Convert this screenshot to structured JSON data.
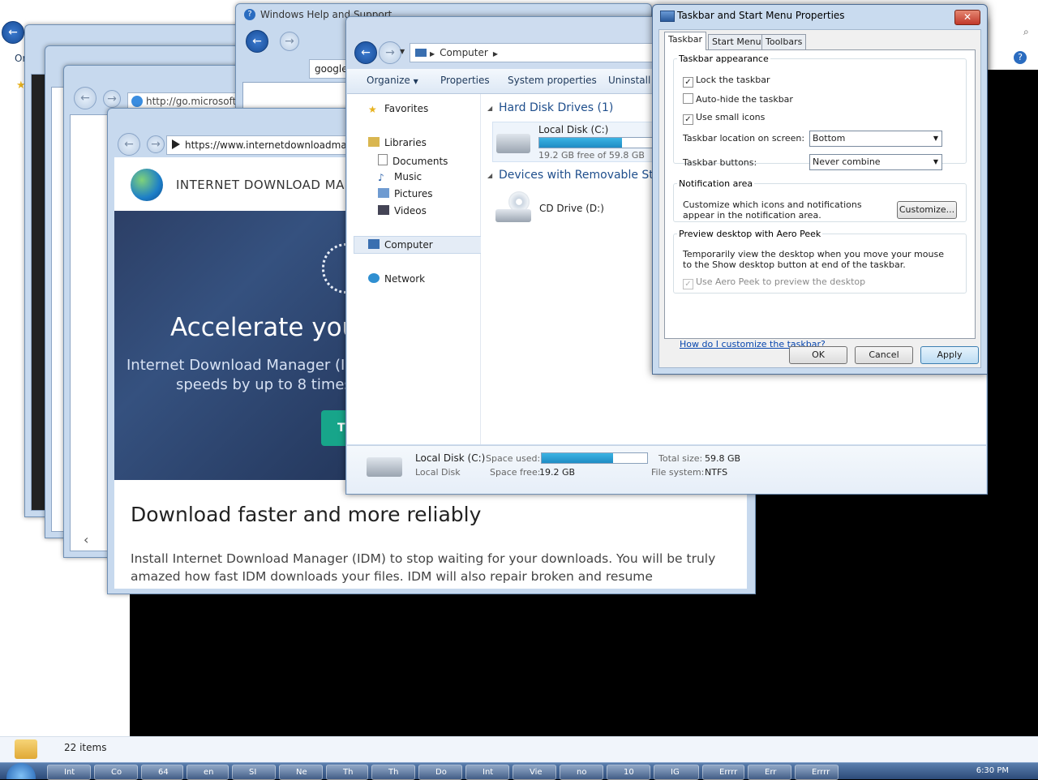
{
  "background_explorer": {
    "status_items": "22 items",
    "toolbar_fragment": "Or"
  },
  "help_window": {
    "title": "Windows Help and Support",
    "search_value": "google"
  },
  "go_microsoft_window": {
    "url": "http://go.microsoft."
  },
  "idm_browser": {
    "url": "https://www.internetdownloadmana",
    "brand": "INTERNET DOWNLOAD MA",
    "hero_title": "Accelerate your",
    "hero_sub1": "Internet Download Manager (IDM",
    "hero_sub2": "speeds by up to 8 times,",
    "cta_fragment": "TI",
    "heading": "Download faster and more reliably",
    "paragraph": "Install Internet Download Manager (IDM) to stop waiting for your downloads. You will be truly amazed how fast IDM downloads your files. IDM will also repair broken and resume interrupted downloads due"
  },
  "explorer": {
    "address_path": "Computer",
    "toolbar": {
      "organize": "Organize",
      "properties": "Properties",
      "system_properties": "System properties",
      "uninstall": "Uninstall o"
    },
    "nav": {
      "favorites": "Favorites",
      "libraries": "Libraries",
      "documents": "Documents",
      "music": "Music",
      "pictures": "Pictures",
      "videos": "Videos",
      "computer": "Computer",
      "network": "Network"
    },
    "groups": {
      "hard_disk": "Hard Disk Drives (1)",
      "removable": "Devices with Removable Sto"
    },
    "local_disk": {
      "name": "Local Disk (C:)",
      "free_text": "19.2 GB free of 59.8 GB",
      "used_fraction": 0.68
    },
    "cd_drive": "CD Drive (D:)",
    "details": {
      "name": "Local Disk (C:)",
      "type": "Local Disk",
      "space_used_label": "Space used:",
      "space_free_label": "Space free:",
      "space_free_value": "19.2 GB",
      "total_size_label": "Total size:",
      "total_size_value": "59.8 GB",
      "file_system_label": "File system:",
      "file_system_value": "NTFS"
    }
  },
  "dialog": {
    "title": "Taskbar and Start Menu Properties",
    "close_glyph": "✕",
    "tabs": [
      "Taskbar",
      "Start Menu",
      "Toolbars"
    ],
    "appearance_legend": "Taskbar appearance",
    "lock_taskbar": "Lock the taskbar",
    "auto_hide": "Auto-hide the taskbar",
    "small_icons": "Use small icons",
    "location_label": "Taskbar location on screen:",
    "location_value": "Bottom",
    "buttons_label": "Taskbar buttons:",
    "buttons_value": "Never combine",
    "notification_legend": "Notification area",
    "notification_text": "Customize which icons and notifications appear in the notification area.",
    "customize_button": "Customize...",
    "aero_legend": "Preview desktop with Aero Peek",
    "aero_text": "Temporarily view the desktop when you move your mouse to the Show desktop button at end of the taskbar.",
    "aero_checkbox": "Use Aero Peek to preview the desktop",
    "help_link": "How do I customize the taskbar?",
    "ok": "OK",
    "cancel": "Cancel",
    "apply": "Apply"
  },
  "taskbar": {
    "items": [
      "Int",
      "Co",
      "64",
      "en",
      "SI",
      "Ne",
      "Th",
      "Th",
      "Do",
      "Int",
      "Vie",
      "no",
      "10",
      "IG",
      "Errrr",
      "Err",
      "Errrr"
    ],
    "clock": "6:30 PM"
  },
  "colors": {
    "accent": "#1e4e8c",
    "link": "#0645ad",
    "idm_cta": "#17a58a",
    "close_red": "#c1392b"
  }
}
